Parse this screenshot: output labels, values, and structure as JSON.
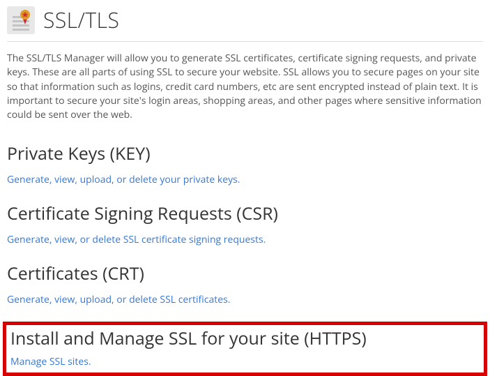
{
  "page": {
    "title": "SSL/TLS",
    "description": "The SSL/TLS Manager will allow you to generate SSL certificates, certificate signing requests, and private keys. These are all parts of using SSL to secure your website. SSL allows you to secure pages on your site so that information such as logins, credit card numbers, etc are sent encrypted instead of plain text. It is important to secure your site's login areas, shopping areas, and other pages where sensitive information could be sent over the web."
  },
  "sections": {
    "key": {
      "heading": "Private Keys (KEY)",
      "link": "Generate, view, upload, or delete your private keys."
    },
    "csr": {
      "heading": "Certificate Signing Requests (CSR)",
      "link": "Generate, view, or delete SSL certificate signing requests."
    },
    "crt": {
      "heading": "Certificates (CRT)",
      "link": "Generate, view, upload, or delete SSL certificates."
    },
    "install": {
      "heading": "Install and Manage SSL for your site (HTTPS)",
      "link": "Manage SSL sites."
    }
  }
}
